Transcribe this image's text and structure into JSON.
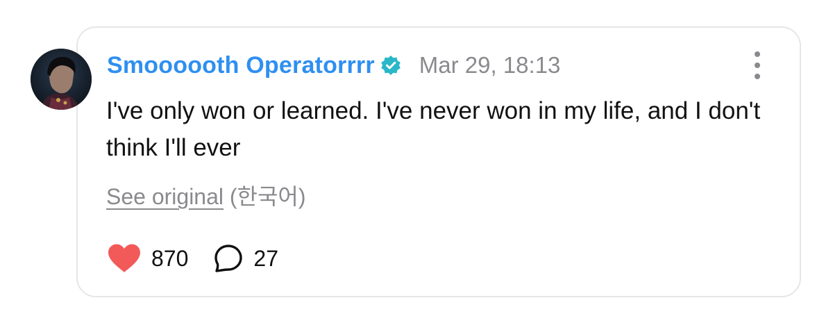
{
  "post": {
    "author": "Smoooooth Operatorrrr",
    "verified_icon": "verified-badge-icon",
    "timestamp": "Mar 29, 18:13",
    "text": "I've only won or learned. I've never won in my life, and I don't think I'll ever",
    "see_original_label": "See original",
    "original_language": "(한국어)",
    "likes": "870",
    "replies": "27"
  },
  "colors": {
    "author": "#2f8ff0",
    "verified": "#2ab7c9",
    "heart": "#f25a5a",
    "muted": "#8a8a8e",
    "border": "#e6e6ea"
  },
  "icons": {
    "more": "more-vertical-icon",
    "like": "heart-icon",
    "reply": "speech-bubble-icon"
  }
}
